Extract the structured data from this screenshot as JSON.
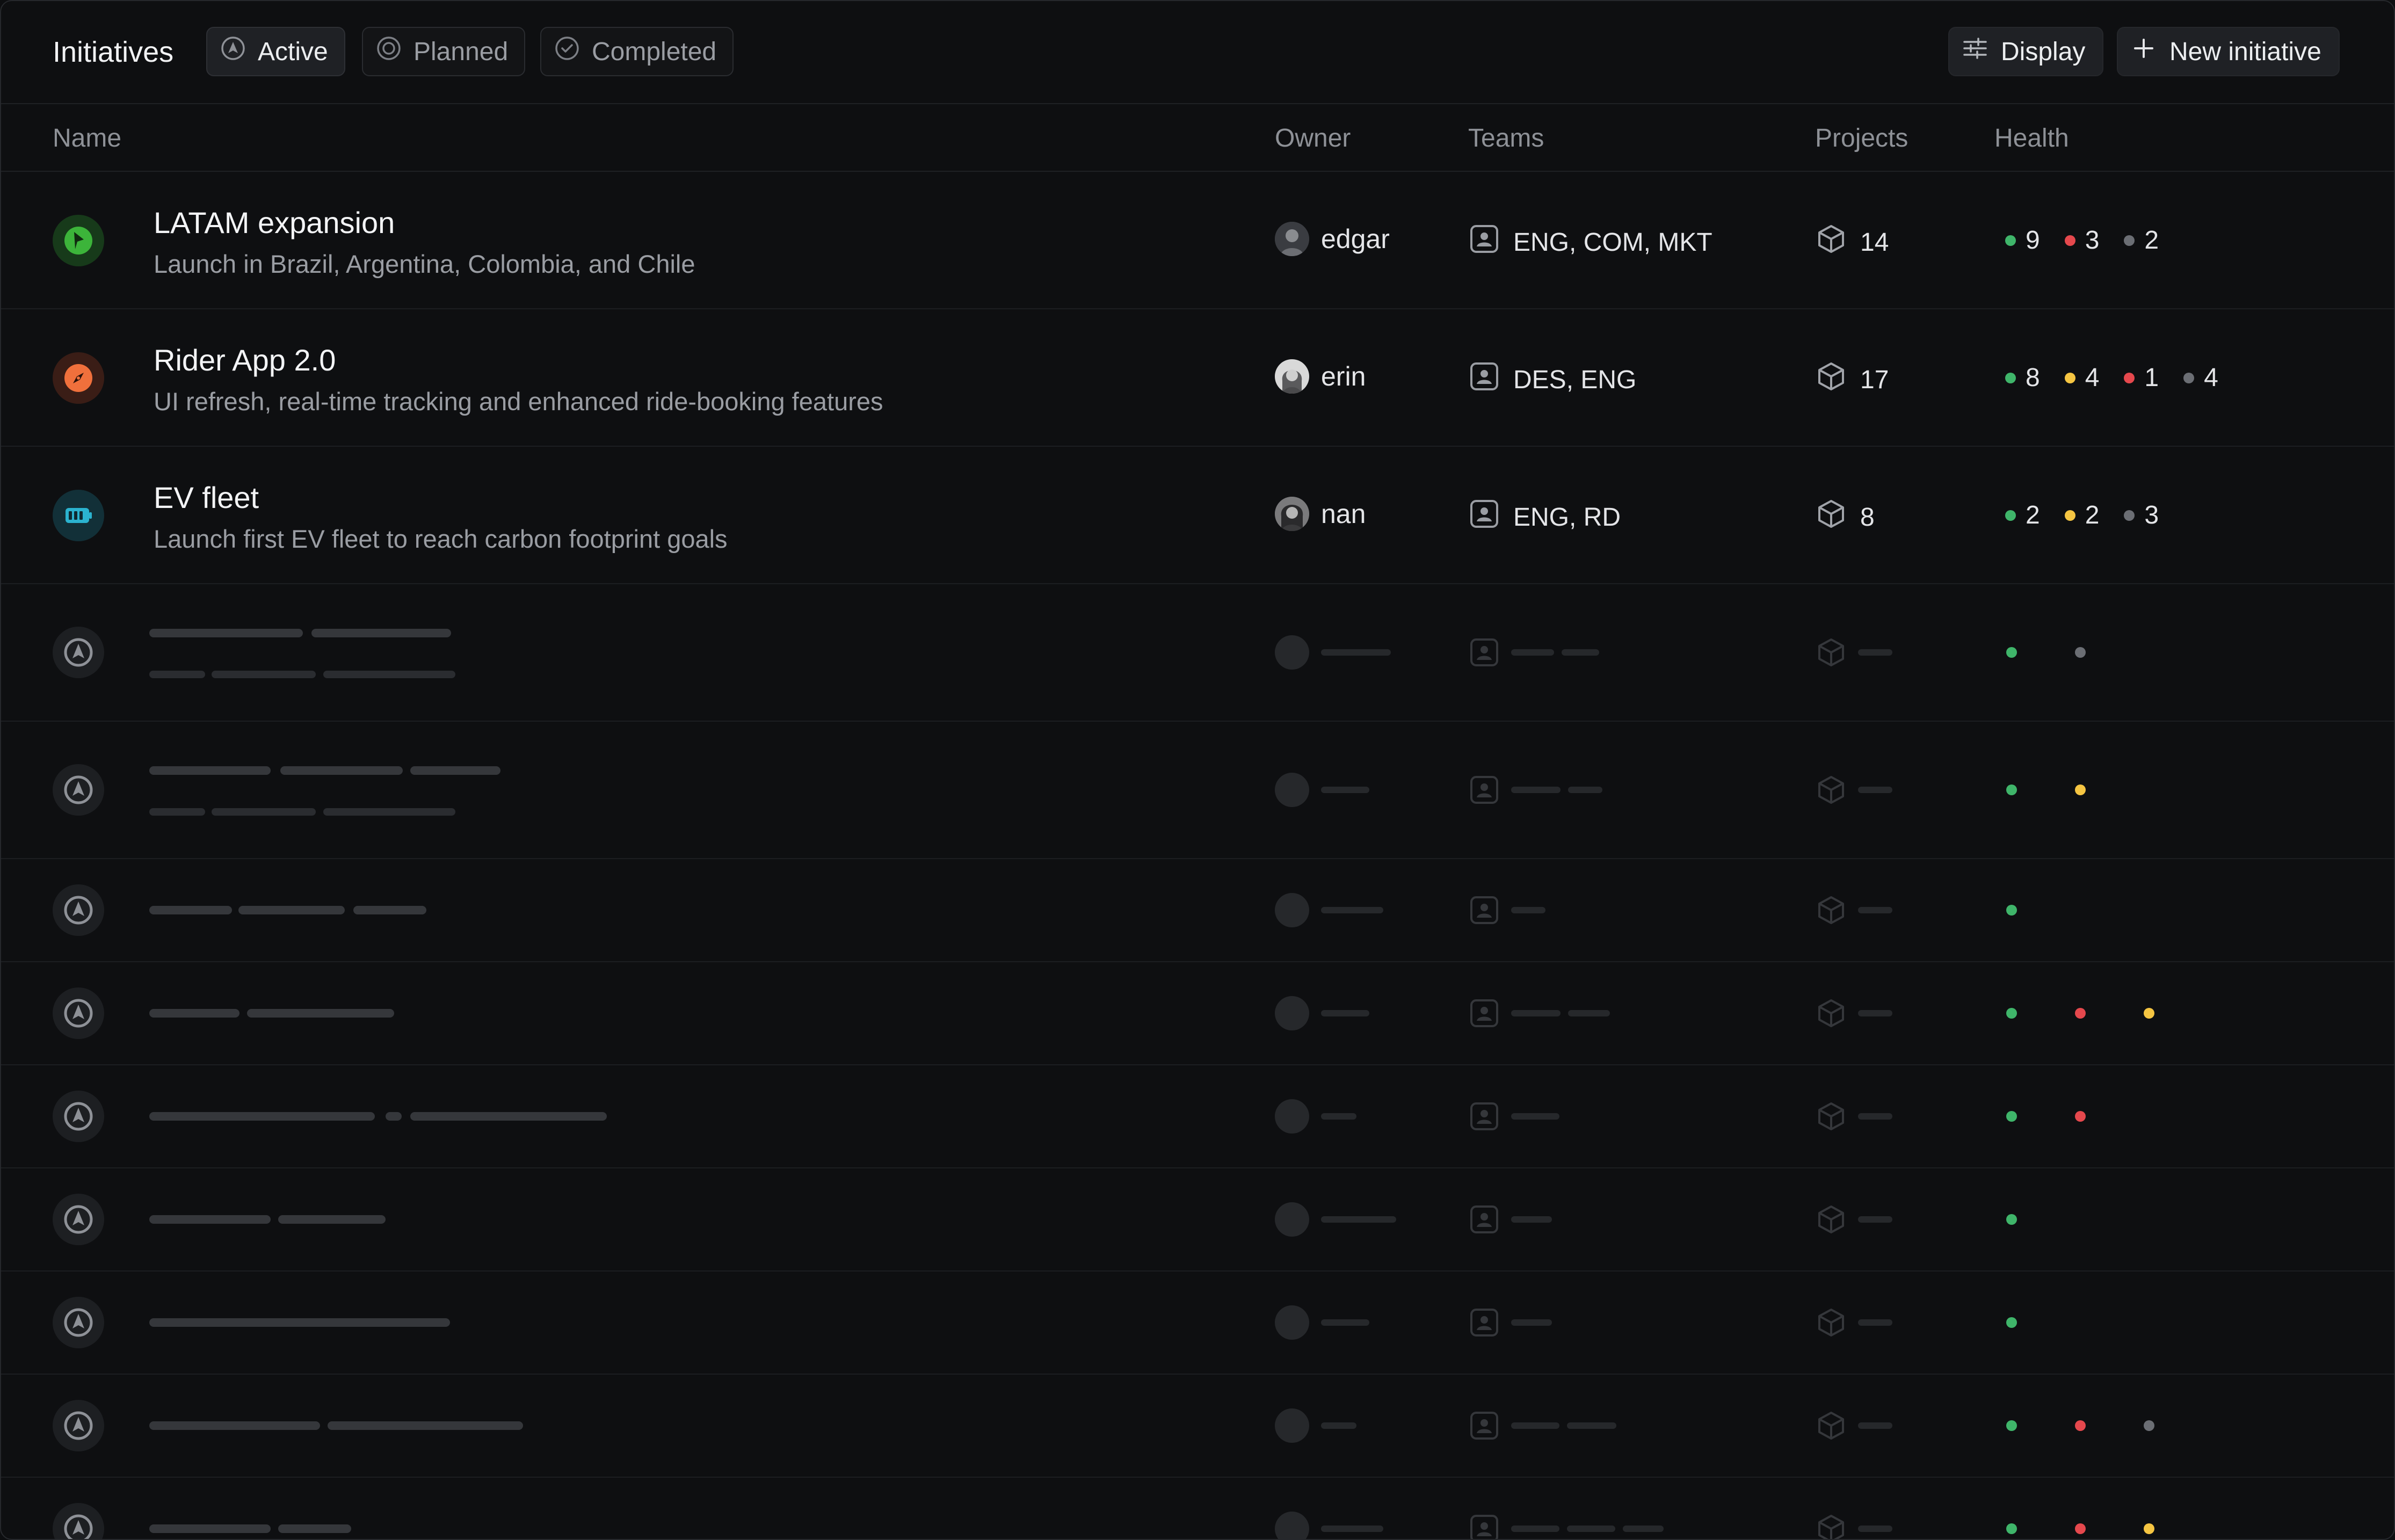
{
  "header": {
    "title": "Initiatives",
    "tabs": [
      {
        "label": "Active",
        "icon": "active-icon"
      },
      {
        "label": "Planned",
        "icon": "planned-icon"
      },
      {
        "label": "Completed",
        "icon": "completed-icon"
      }
    ],
    "display_label": "Display",
    "new_label": "New initiative"
  },
  "columns": {
    "name": "Name",
    "owner": "Owner",
    "teams": "Teams",
    "projects": "Projects",
    "health": "Health"
  },
  "colors": {
    "green": "#3fb56a",
    "red": "#e5484d",
    "yellow": "#f5c542",
    "gray": "#6b6e74"
  },
  "initiatives": [
    {
      "title": "LATAM expansion",
      "description": "Launch in Brazil, Argentina, Colombia, and Chile",
      "icon": "flag-icon",
      "owner": "edgar",
      "teams": "ENG, COM, MKT",
      "projects": "14",
      "health": [
        {
          "status": "green",
          "count": "9"
        },
        {
          "status": "red",
          "count": "3"
        },
        {
          "status": "gray",
          "count": "2"
        }
      ]
    },
    {
      "title": "Rider App 2.0",
      "description": "UI refresh, real-time tracking and enhanced ride-booking features",
      "icon": "compass-icon",
      "owner": "erin",
      "teams": "DES, ENG",
      "projects": "17",
      "health": [
        {
          "status": "green",
          "count": "8"
        },
        {
          "status": "yellow",
          "count": "4"
        },
        {
          "status": "red",
          "count": "1"
        },
        {
          "status": "gray",
          "count": "4"
        }
      ]
    },
    {
      "title": "EV fleet",
      "description": "Launch first EV fleet to reach carbon footprint goals",
      "icon": "battery-icon",
      "owner": "nan",
      "teams": "ENG, RD",
      "projects": "8",
      "health": [
        {
          "status": "green",
          "count": "2"
        },
        {
          "status": "yellow",
          "count": "2"
        },
        {
          "status": "gray",
          "count": "3"
        }
      ]
    }
  ],
  "placeholder_rows": [
    {
      "health": [
        "green",
        "gray"
      ]
    },
    {
      "health": [
        "green",
        "yellow"
      ]
    },
    {
      "health": [
        "green"
      ]
    },
    {
      "health": [
        "green",
        "red",
        "yellow"
      ]
    },
    {
      "health": [
        "green",
        "red"
      ]
    },
    {
      "health": [
        "green"
      ]
    },
    {
      "health": [
        "green"
      ]
    },
    {
      "health": [
        "green",
        "red",
        "gray"
      ]
    },
    {
      "health": [
        "green",
        "red",
        "yellow"
      ]
    }
  ]
}
